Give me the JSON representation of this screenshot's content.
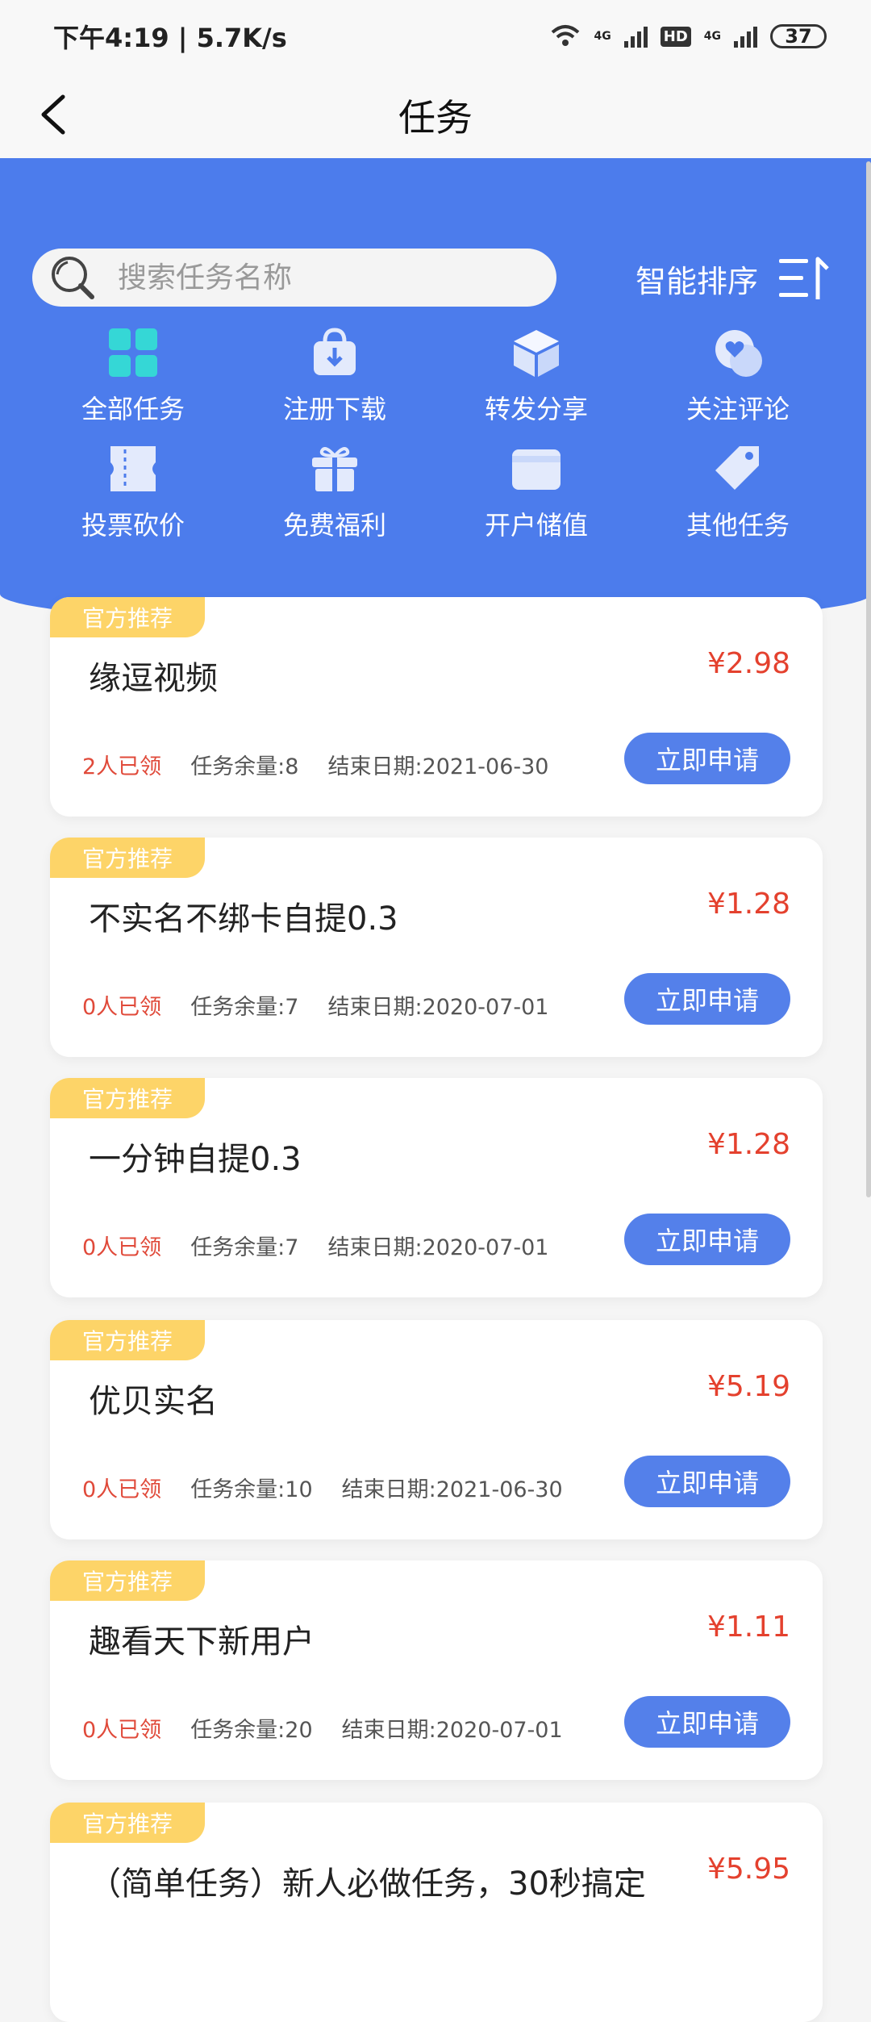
{
  "status": {
    "time_speed": "下午4:19 | 5.7K/s",
    "net1": "4G",
    "hd": "HD",
    "net2": "4G",
    "battery": "37"
  },
  "header": {
    "title": "任务"
  },
  "search": {
    "placeholder": "搜索任务名称",
    "value": ""
  },
  "sort": {
    "label": "智能排序"
  },
  "categories": [
    {
      "label": "全部任务",
      "icon": "grid-icon"
    },
    {
      "label": "注册下载",
      "icon": "download-bag-icon"
    },
    {
      "label": "转发分享",
      "icon": "cube-icon"
    },
    {
      "label": "关注评论",
      "icon": "heart-chat-icon"
    },
    {
      "label": "投票砍价",
      "icon": "ticket-icon"
    },
    {
      "label": "免费福利",
      "icon": "gift-icon"
    },
    {
      "label": "开户储值",
      "icon": "wallet-icon"
    },
    {
      "label": "其他任务",
      "icon": "tag-icon"
    }
  ],
  "tasks": [
    {
      "badge": "官方推荐",
      "title": "缘逗视频",
      "price": "¥2.98",
      "claimed": "2人已领",
      "remaining": "任务余量:8",
      "end": "结束日期:2021-06-30",
      "button": "立即申请"
    },
    {
      "badge": "官方推荐",
      "title": "不实名不绑卡自提0.3",
      "price": "¥1.28",
      "claimed": "0人已领",
      "remaining": "任务余量:7",
      "end": "结束日期:2020-07-01",
      "button": "立即申请"
    },
    {
      "badge": "官方推荐",
      "title": "一分钟自提0.3",
      "price": "¥1.28",
      "claimed": "0人已领",
      "remaining": "任务余量:7",
      "end": "结束日期:2020-07-01",
      "button": "立即申请"
    },
    {
      "badge": "官方推荐",
      "title": "优贝实名",
      "price": "¥5.19",
      "claimed": "0人已领",
      "remaining": "任务余量:10",
      "end": "结束日期:2021-06-30",
      "button": "立即申请"
    },
    {
      "badge": "官方推荐",
      "title": "趣看天下新用户",
      "price": "¥1.11",
      "claimed": "0人已领",
      "remaining": "任务余量:20",
      "end": "结束日期:2020-07-01",
      "button": "立即申请"
    },
    {
      "badge": "官方推荐",
      "title": "（简单任务）新人必做任务，30秒搞定",
      "price": "¥5.95",
      "claimed": "",
      "remaining": "",
      "end": "",
      "button": ""
    }
  ],
  "colors": {
    "accent": "#4c7cec",
    "badge": "#fdd468",
    "price": "#e4412e",
    "button": "#5480ea"
  }
}
